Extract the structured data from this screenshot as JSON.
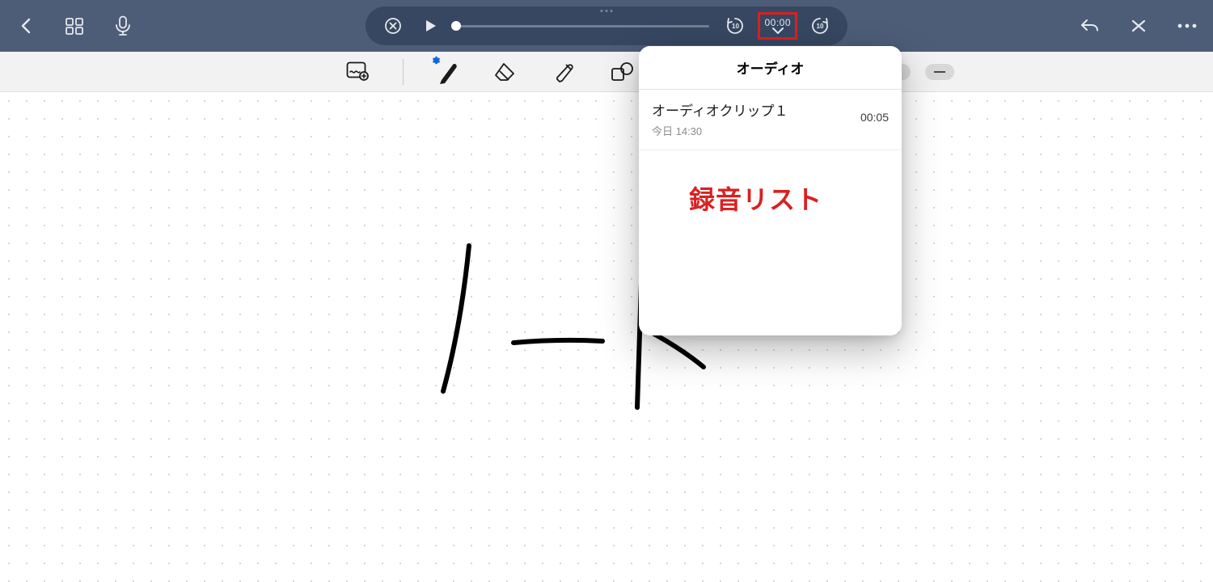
{
  "colors": {
    "topbar_bg": "#4d5d77",
    "pill_bg": "#374761",
    "highlight": "#d92121"
  },
  "player": {
    "current_time": "00:00",
    "rewind_seconds": "10",
    "forward_seconds": "10"
  },
  "popup": {
    "title": "オーディオ",
    "clips": [
      {
        "title": "オーディオクリップ１",
        "timestamp": "今日 14:30",
        "duration": "00:05"
      }
    ]
  },
  "canvas": {
    "handwriting_text_approx": "ノート"
  },
  "annotation": {
    "label": "録音リスト"
  }
}
